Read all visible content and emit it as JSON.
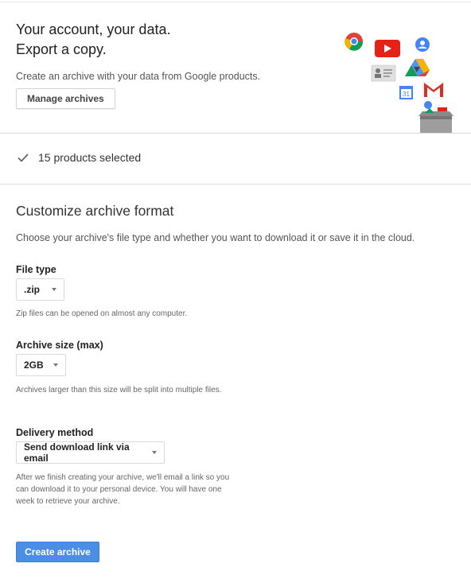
{
  "hero": {
    "title_line1": "Your account, your data.",
    "title_line2": "Export a copy.",
    "description": "Create an archive with your data from Google products.",
    "manage_button": "Manage archives",
    "illustration_icons": [
      "chrome-icon",
      "youtube-icon",
      "google-plus-icon",
      "contacts-icon",
      "drive-icon",
      "calendar-icon",
      "gmail-icon",
      "archive-box-icon"
    ],
    "calendar_day": "31"
  },
  "selection": {
    "icon": "check-icon",
    "summary": "15 products selected"
  },
  "customize": {
    "title": "Customize archive format",
    "description": "Choose your archive's file type and whether you want to download it or save it in the cloud.",
    "file_type": {
      "label": "File type",
      "value": ".zip",
      "helper": "Zip files can be opened on almost any computer."
    },
    "archive_size": {
      "label": "Archive size (max)",
      "value": "2GB",
      "helper": "Archives larger than this size will be split into multiple files."
    },
    "delivery": {
      "label": "Delivery method",
      "value": "Send download link via email",
      "helper": "After we finish creating your archive, we'll email a link so you can download it to your personal device. You will have one week to retrieve your archive."
    },
    "create_button": "Create archive"
  },
  "colors": {
    "primary": "#4d8ee5",
    "youtube": "#e62117",
    "gmail": "#d93025",
    "divider": "#dcdcdc"
  }
}
